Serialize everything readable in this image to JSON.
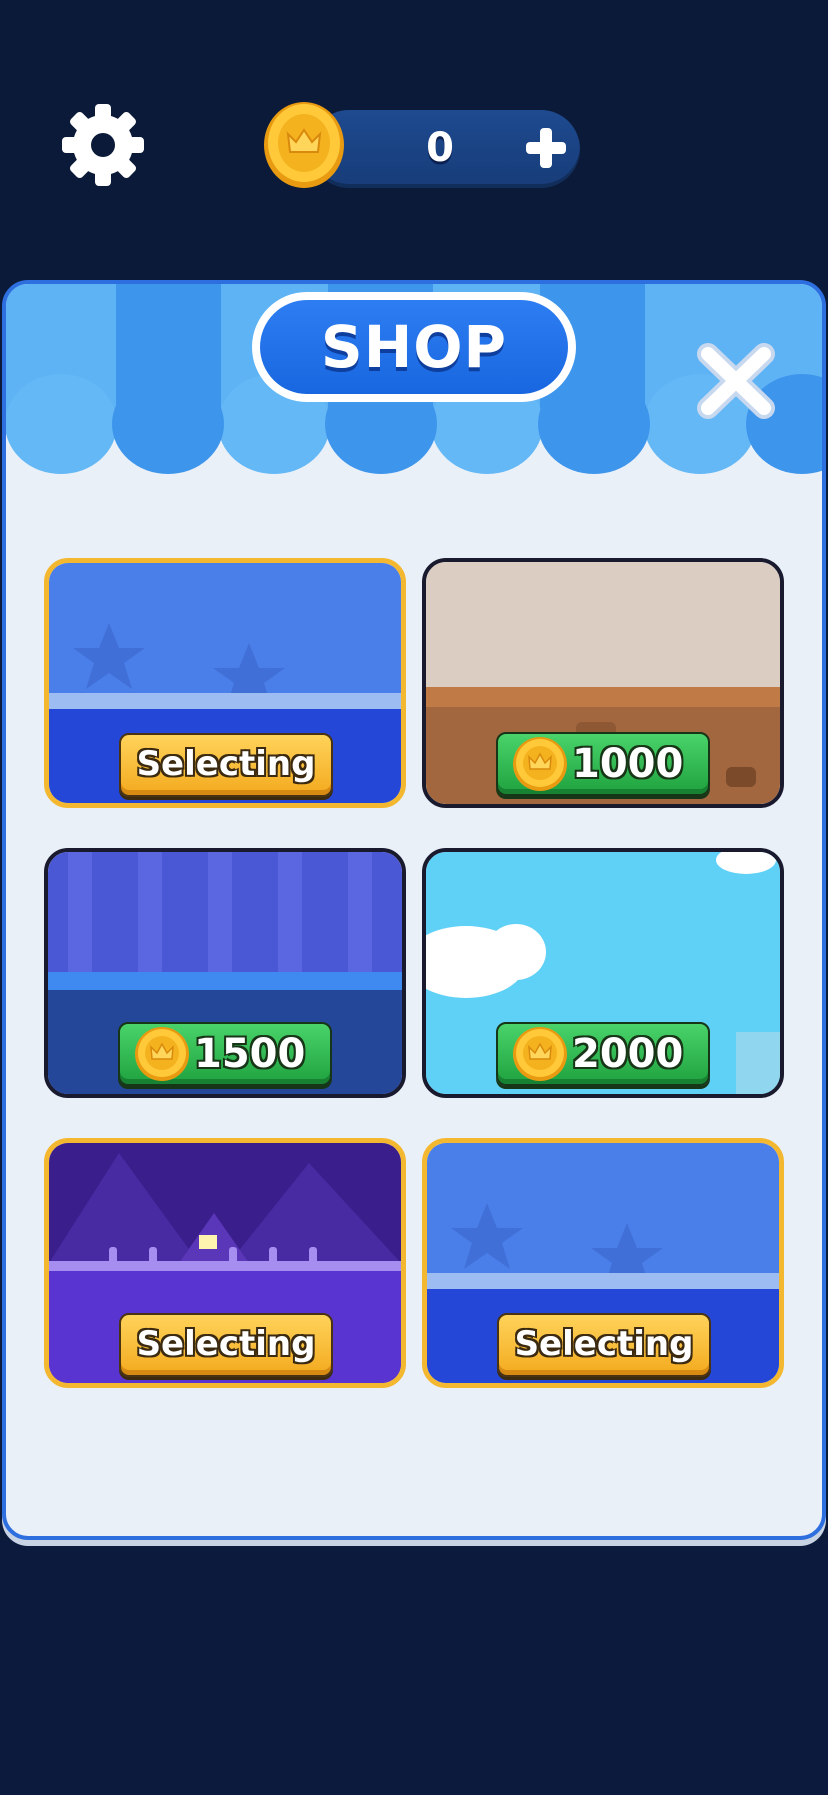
{
  "hud": {
    "coin_count": "0",
    "settings_icon": "gear-icon",
    "coin_icon": "crown-coin-icon",
    "plus_icon": "plus-icon"
  },
  "shop": {
    "title": "SHOP",
    "close_icon": "close-x-icon",
    "items": [
      {
        "theme": "blue-stars",
        "state": "selected",
        "label": "Selecting"
      },
      {
        "theme": "desert-brick",
        "state": "locked",
        "price": "1000"
      },
      {
        "theme": "purple-castle",
        "state": "locked",
        "price": "1500"
      },
      {
        "theme": "sky-clouds",
        "state": "locked",
        "price": "2000"
      },
      {
        "theme": "night-village",
        "state": "selected",
        "label": "Selecting"
      },
      {
        "theme": "blue-stars",
        "state": "selected",
        "label": "Selecting"
      }
    ]
  },
  "colors": {
    "background": "#0b1a38",
    "panel": "#e9f0f8",
    "accent_blue": "#1867e0",
    "selected_border": "#f4b730",
    "price_green": "#1fa23f"
  }
}
